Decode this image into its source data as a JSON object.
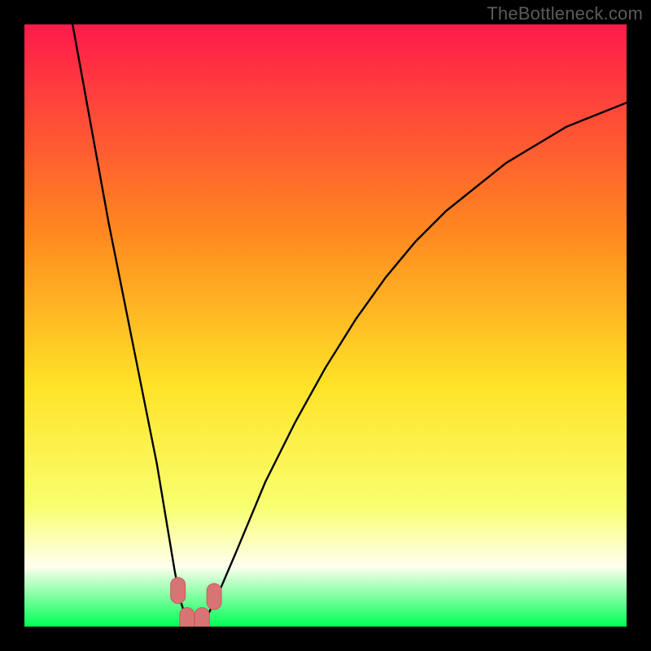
{
  "watermark": "TheBottleneck.com",
  "colors": {
    "bg": "#000000",
    "grad_top": "#ff1a4b",
    "grad_upper_mid": "#ff8a1f",
    "grad_mid": "#ffe328",
    "grad_lower_mid": "#f8ff6f",
    "grad_lower": "#ffffee",
    "grad_bottom": "#00ff55",
    "curve": "#000000",
    "marker_fill": "#d97474",
    "marker_stroke": "#c65e5e"
  },
  "chart_data": {
    "type": "line",
    "title": "",
    "xlabel": "",
    "ylabel": "",
    "xlim": [
      0,
      100
    ],
    "ylim": [
      0,
      100
    ],
    "series": [
      {
        "name": "bottleneck-curve",
        "x": [
          8,
          10,
          12,
          14,
          16,
          18,
          20,
          22,
          24,
          25,
          26,
          27,
          28,
          29,
          30,
          32,
          35,
          40,
          45,
          50,
          55,
          60,
          65,
          70,
          75,
          80,
          85,
          90,
          95,
          100
        ],
        "y": [
          100,
          89,
          78,
          67,
          57,
          47,
          37,
          27,
          15,
          9,
          4,
          1,
          0,
          0,
          1,
          5,
          12,
          24,
          34,
          43,
          51,
          58,
          64,
          69,
          73,
          77,
          80,
          83,
          85,
          87
        ]
      }
    ],
    "markers": [
      {
        "name": "left-bottom-marker",
        "x": 25.5,
        "y": 6
      },
      {
        "name": "trough-left-marker",
        "x": 27.0,
        "y": 1
      },
      {
        "name": "trough-right-marker",
        "x": 29.5,
        "y": 1
      },
      {
        "name": "right-rise-marker",
        "x": 31.5,
        "y": 5
      }
    ],
    "gradient_stops": [
      {
        "pct": 0,
        "key": "grad_top"
      },
      {
        "pct": 35,
        "key": "grad_upper_mid"
      },
      {
        "pct": 60,
        "key": "grad_mid"
      },
      {
        "pct": 80,
        "key": "grad_lower_mid"
      },
      {
        "pct": 90,
        "key": "grad_lower"
      },
      {
        "pct": 100,
        "key": "grad_bottom"
      }
    ]
  }
}
